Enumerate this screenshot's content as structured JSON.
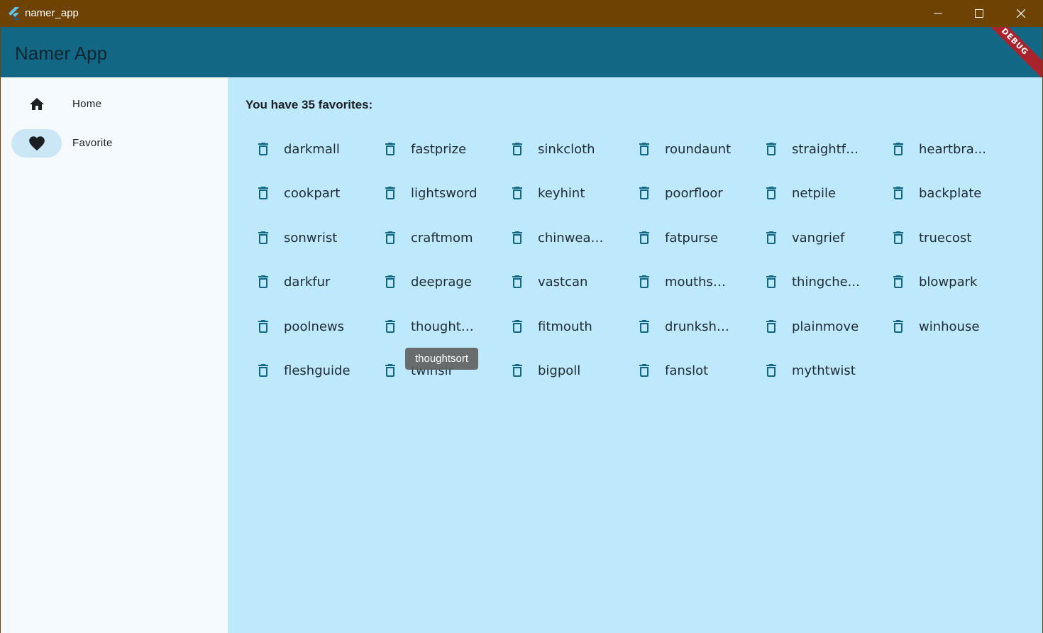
{
  "window": {
    "title": "namer_app",
    "minimize_icon": "minimize-icon",
    "maximize_icon": "maximize-icon",
    "close_icon": "close-icon"
  },
  "appbar": {
    "title": "Namer App",
    "debug_banner": "DEBUG"
  },
  "rail": {
    "items": [
      {
        "label": "Home",
        "icon": "home-icon",
        "selected": false
      },
      {
        "label": "Favorite",
        "icon": "heart-icon",
        "selected": true
      }
    ]
  },
  "main": {
    "heading": "You have 35 favorites:",
    "favorites": [
      "darkmall",
      "fastprize",
      "sinkcloth",
      "roundaunt",
      "straightfr...",
      "heartbra...",
      "cookpart",
      "lightsword",
      "keyhint",
      "poorfloor",
      "netpile",
      "backplate",
      "sonwrist",
      "craftmom",
      "chinwealth",
      "fatpurse",
      "vangrief",
      "truecost",
      "darkfur",
      "deeprage",
      "vastcan",
      "mouthsp...",
      "thingche...",
      "blowpark",
      "poolnews",
      "thoughts...",
      "fitmouth",
      "drunksha...",
      "plainmove",
      "winhouse",
      "fleshguide",
      "twinsir",
      "bigpoll",
      "fanslot",
      "mythtwist"
    ],
    "tooltip": "thoughtsort"
  },
  "colors": {
    "title_bar": "#6e4203",
    "app_bar": "#126785",
    "rail_bg": "#f5faff",
    "rail_selected": "#cbe6f5",
    "main_bg": "#bee8fb",
    "icon": "#126785"
  }
}
